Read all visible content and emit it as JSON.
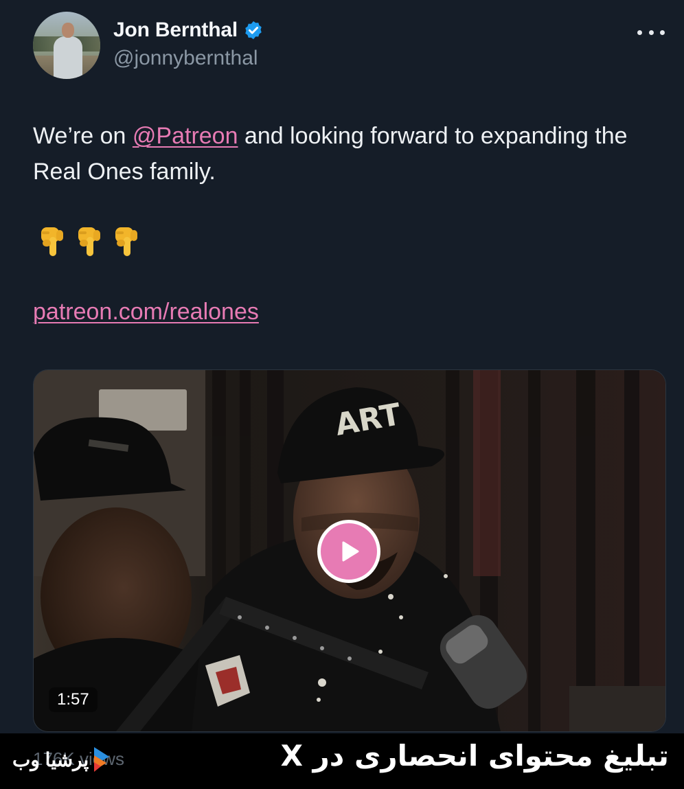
{
  "tweet": {
    "author_name": "Jon Bernthal",
    "author_handle": "@jonnybernthal",
    "text_before_mention": "We’re on ",
    "mention": "@Patreon",
    "text_after_mention": " and looking forward to expanding the Real Ones family.",
    "emoji_count": 3,
    "link": "patreon.com/realones",
    "icons": [
      "verified-badge-icon",
      "more-options-icon",
      "pointing-down-hand-emoji",
      "play-icon"
    ]
  },
  "video": {
    "duration": "1:57",
    "cap_text": "ART"
  },
  "footer": {
    "views": "176K views",
    "brand": "پرشیا وب",
    "promo_text": "تبلیغ محتوای انحصاری در X"
  },
  "colors": {
    "background": "#151d28",
    "accent": "#e77bb4",
    "verified": "#1d9bf0",
    "banner": "#000000"
  }
}
